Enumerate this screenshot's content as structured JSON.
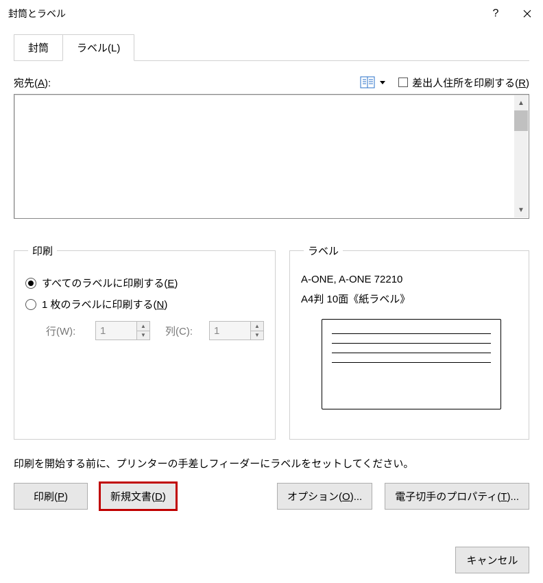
{
  "window": {
    "title": "封筒とラベル"
  },
  "tabs": {
    "envelope": "封筒",
    "label": "ラベル(L)"
  },
  "address": {
    "label_prefix": "宛先(",
    "label_hotkey": "A",
    "label_suffix": "):",
    "value": ""
  },
  "return_addr": {
    "checkbox_prefix": "差出人住所を印刷する(",
    "checkbox_hotkey": "R",
    "checkbox_suffix": ")",
    "checked": false
  },
  "print_group": {
    "legend": "印刷",
    "opt_all_prefix": "すべてのラベルに印刷する(",
    "opt_all_hotkey": "E",
    "opt_all_suffix": ")",
    "opt_one_prefix": "1 枚のラベルに印刷する(",
    "opt_one_hotkey": "N",
    "opt_one_suffix": ")",
    "row_label": "行(W):",
    "row_value": "1",
    "col_label": "列(C):",
    "col_value": "1"
  },
  "label_group": {
    "legend": "ラベル",
    "line1": "A-ONE, A-ONE 72210",
    "line2": "A4判 10面《紙ラベル》"
  },
  "hint": "印刷を開始する前に、プリンターの手差しフィーダーにラベルをセットしてください。",
  "buttons": {
    "print_prefix": "印刷(",
    "print_hotkey": "P",
    "print_suffix": ")",
    "newdoc_prefix": "新規文書(",
    "newdoc_hotkey": "D",
    "newdoc_suffix": ")",
    "options_prefix": "オプション(",
    "options_hotkey": "O",
    "options_suffix": ")...",
    "epostage_prefix": "電子切手のプロパティ(",
    "epostage_hotkey": "T",
    "epostage_suffix": ")...",
    "cancel": "キャンセル"
  }
}
